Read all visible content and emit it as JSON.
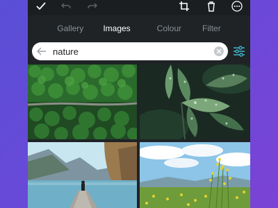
{
  "tabs": [
    {
      "label": "Gallery",
      "active": false
    },
    {
      "label": "Images",
      "active": true
    },
    {
      "label": "Colour",
      "active": false
    },
    {
      "label": "Filter",
      "active": false
    }
  ],
  "search": {
    "value": "nature"
  },
  "images": [
    {
      "name": "aerial-forest-road-photo"
    },
    {
      "name": "wet-leaves-raindrops-photo"
    },
    {
      "name": "lake-mountains-person-on-pier-photo"
    },
    {
      "name": "yellow-wildflowers-field-photo"
    }
  ],
  "colors": {
    "background_gradient_start": "#5a4fd6",
    "background_gradient_end": "#7b43d6",
    "panel": "#1f2326",
    "tab_active": "#ffffff",
    "tab_inactive": "#8a9096",
    "filter_accent": "#3fb8d1"
  }
}
